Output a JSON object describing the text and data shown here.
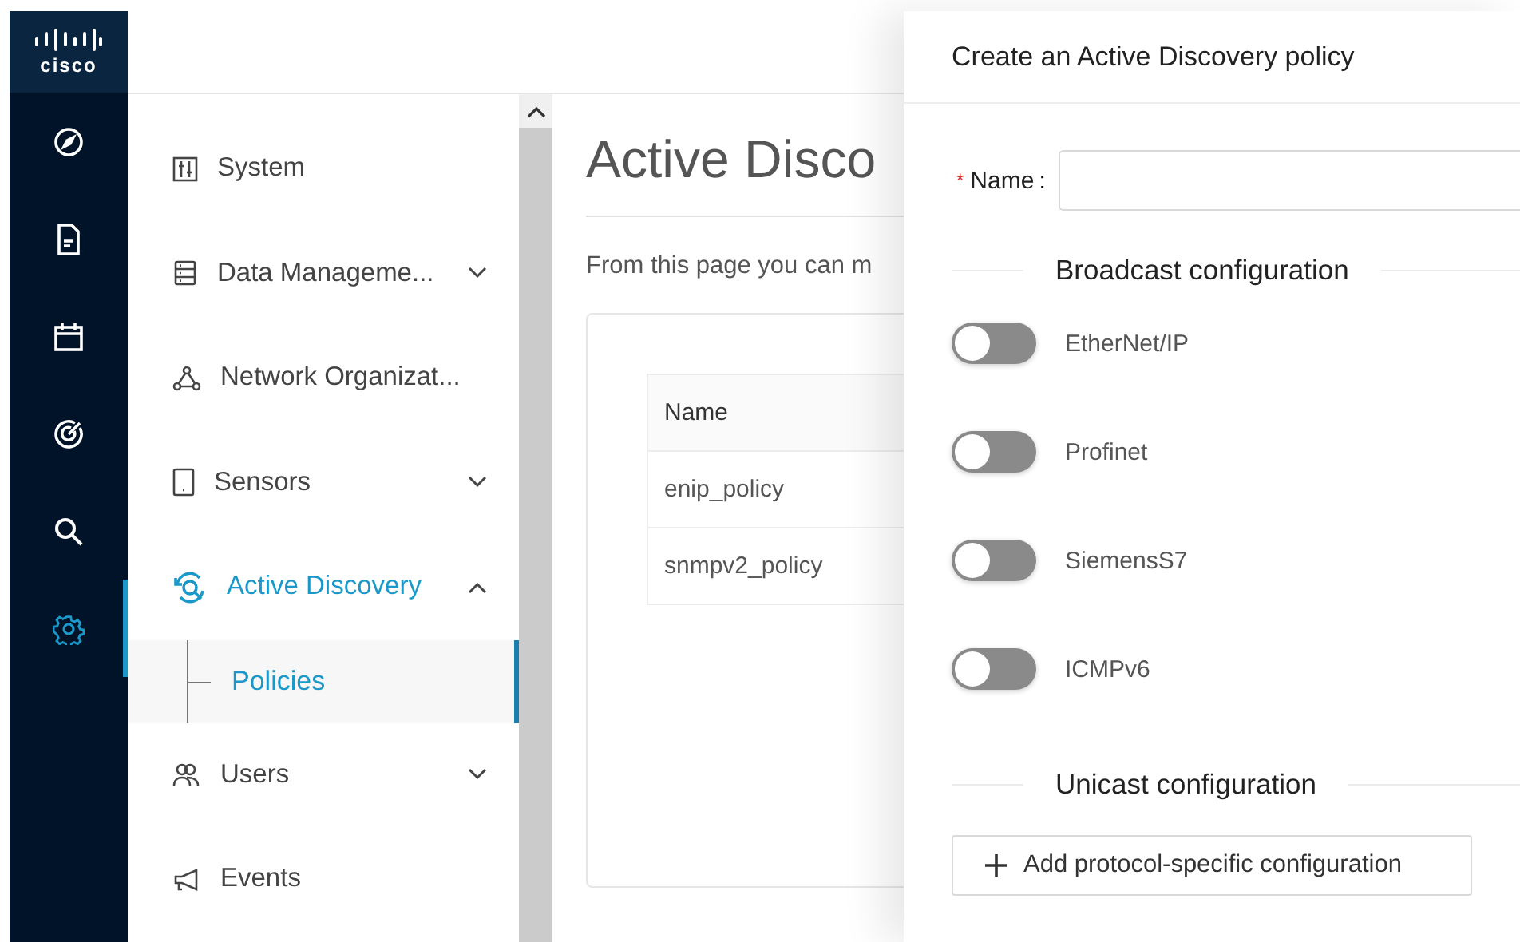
{
  "logo": {
    "text": "cisco"
  },
  "rail": [
    {
      "selected": false
    },
    {
      "selected": false
    },
    {
      "selected": false
    },
    {
      "selected": false
    },
    {
      "selected": false
    },
    {
      "selected": true
    }
  ],
  "sidebar": {
    "items": [
      {
        "label": "System",
        "selected": false
      },
      {
        "label": "Data Manageme...",
        "expanded": false,
        "selected": false
      },
      {
        "label": "Network Organizat...",
        "selected": false
      },
      {
        "label": "Sensors",
        "expanded": false,
        "selected": false
      },
      {
        "label": "Active Discovery",
        "expanded": true,
        "selected": true,
        "children": [
          {
            "label": "Policies",
            "selected": true
          }
        ]
      },
      {
        "label": "Users",
        "expanded": false,
        "selected": false
      },
      {
        "label": "Events",
        "selected": false
      }
    ]
  },
  "main": {
    "title": "Active Disco",
    "description": "From this page you can m",
    "table": {
      "columns": [
        "Name"
      ],
      "rows": [
        [
          "enip_policy"
        ],
        [
          "snmpv2_policy"
        ]
      ]
    }
  },
  "drawer": {
    "title": "Create an Active Discovery policy",
    "name_field": {
      "required_mark": "*",
      "label": "Name",
      "colon": ":"
    },
    "sections": [
      {
        "title": "Broadcast configuration",
        "toggles": [
          {
            "label": "EtherNet/IP",
            "on": false
          },
          {
            "label": "Profinet",
            "on": false
          },
          {
            "label": "SiemensS7",
            "on": false
          },
          {
            "label": "ICMPv6",
            "on": false
          }
        ]
      },
      {
        "title": "Unicast configuration",
        "button": "Add protocol-specific configuration"
      }
    ]
  }
}
